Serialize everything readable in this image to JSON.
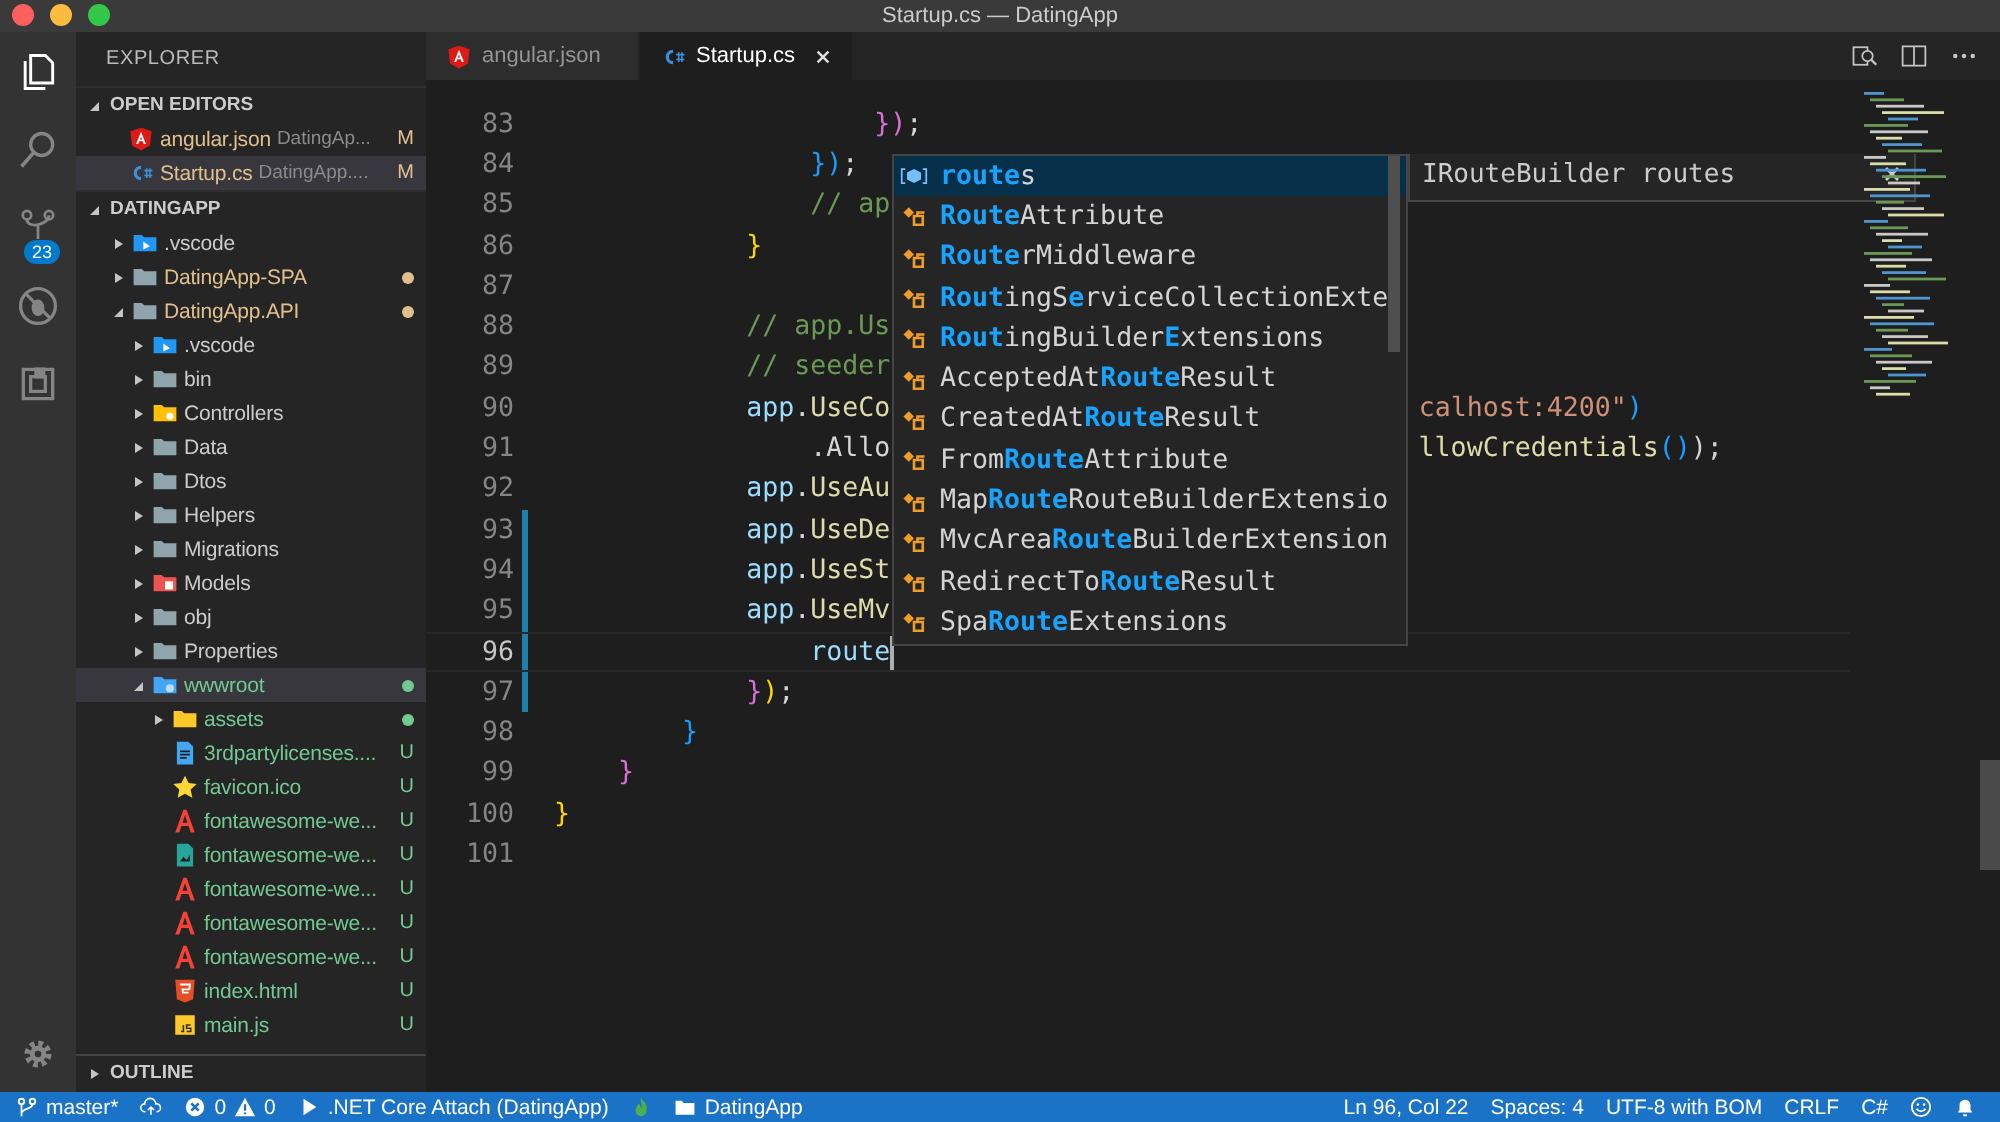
{
  "window": {
    "title": "Startup.cs — DatingApp"
  },
  "activity_bar": {
    "items": [
      {
        "kind": "files",
        "selected": true
      },
      {
        "kind": "search",
        "selected": false
      },
      {
        "kind": "scm",
        "selected": false,
        "badge": "23"
      },
      {
        "kind": "debug",
        "selected": false
      },
      {
        "kind": "extensions",
        "selected": false
      }
    ]
  },
  "sidebar": {
    "title": "EXPLORER",
    "open_editors": {
      "title": "OPEN EDITORS",
      "expanded": true,
      "items": [
        {
          "kind": "angular-file",
          "name": "angular.json",
          "description": "DatingAp...",
          "badge": "M",
          "color": "#e2c08d",
          "selected": false
        },
        {
          "kind": "csharp-file",
          "name": "Startup.cs",
          "description": "DatingApp....",
          "badge": "M",
          "color": "#e2c08d",
          "selected": true
        }
      ]
    },
    "project": {
      "title": "DATINGAPP",
      "expanded": true,
      "items": [
        {
          "kind": "vscode-folder",
          "name": ".vscode",
          "color": "#cccccc",
          "dot": false,
          "expanded": false,
          "selected": false
        },
        {
          "kind": "folder",
          "name": "DatingApp-SPA",
          "color": "#e2c08d",
          "dot": true,
          "expanded": false,
          "selected": false
        },
        {
          "kind": "folder",
          "name": "DatingApp.API",
          "color": "#e2c08d",
          "dot": true,
          "expanded": true,
          "selected": false,
          "children": [
            {
              "kind": "vscode-folder",
              "name": ".vscode",
              "color": "#cccccc",
              "dot": false,
              "expanded": false,
              "selected": false
            },
            {
              "kind": "folder",
              "name": "bin",
              "color": "#cccccc",
              "dot": false,
              "expanded": false,
              "selected": false
            },
            {
              "kind": "controllers-folder",
              "name": "Controllers",
              "color": "#cccccc",
              "dot": false,
              "expanded": false,
              "selected": false
            },
            {
              "kind": "folder",
              "name": "Data",
              "color": "#cccccc",
              "dot": false,
              "expanded": false,
              "selected": false
            },
            {
              "kind": "folder",
              "name": "Dtos",
              "color": "#cccccc",
              "dot": false,
              "expanded": false,
              "selected": false
            },
            {
              "kind": "folder",
              "name": "Helpers",
              "color": "#cccccc",
              "dot": false,
              "expanded": false,
              "selected": false
            },
            {
              "kind": "folder",
              "name": "Migrations",
              "color": "#cccccc",
              "dot": false,
              "expanded": false,
              "selected": false
            },
            {
              "kind": "models-folder",
              "name": "Models",
              "color": "#cccccc",
              "dot": false,
              "expanded": false,
              "selected": false
            },
            {
              "kind": "folder",
              "name": "obj",
              "color": "#cccccc",
              "dot": false,
              "expanded": false,
              "selected": false
            },
            {
              "kind": "folder",
              "name": "Properties",
              "color": "#cccccc",
              "dot": false,
              "expanded": false,
              "selected": false
            },
            {
              "kind": "web-folder",
              "name": "wwwroot",
              "color": "#73c991",
              "dot": true,
              "expanded": true,
              "selected": true,
              "children": [
                {
                  "kind": "assets-folder",
                  "name": "assets",
                  "color": "#73c991",
                  "dot": true,
                  "expanded": false,
                  "selected": false
                },
                {
                  "kind": "doc-file",
                  "name": "3rdpartylicenses....",
                  "color": "#73c991",
                  "badge": "U",
                  "selected": false
                },
                {
                  "kind": "star-file",
                  "name": "favicon.ico",
                  "color": "#73c991",
                  "badge": "U",
                  "selected": false
                },
                {
                  "kind": "font-file",
                  "name": "fontawesome-we...",
                  "color": "#73c991",
                  "badge": "U",
                  "selected": false
                },
                {
                  "kind": "image-file",
                  "name": "fontawesome-we...",
                  "color": "#73c991",
                  "badge": "U",
                  "selected": false
                },
                {
                  "kind": "font-file",
                  "name": "fontawesome-we...",
                  "color": "#73c991",
                  "badge": "U",
                  "selected": false
                },
                {
                  "kind": "font-file",
                  "name": "fontawesome-we...",
                  "color": "#73c991",
                  "badge": "U",
                  "selected": false
                },
                {
                  "kind": "font-file",
                  "name": "fontawesome-we...",
                  "color": "#73c991",
                  "badge": "U",
                  "selected": false
                },
                {
                  "kind": "html-file",
                  "name": "index.html",
                  "color": "#73c991",
                  "badge": "U",
                  "selected": false
                },
                {
                  "kind": "js-file",
                  "name": "main.js",
                  "color": "#73c991",
                  "badge": "U",
                  "selected": false
                }
              ]
            }
          ]
        }
      ]
    },
    "outline": {
      "title": "OUTLINE",
      "expanded": false
    }
  },
  "tabs": [
    {
      "kind": "angular-file",
      "label": "angular.json",
      "selected": false
    },
    {
      "kind": "csharp-file",
      "label": "Startup.cs",
      "selected": true
    }
  ],
  "editor": {
    "lines": [
      {
        "number": "83",
        "changed": false,
        "current": false,
        "tokens": [
          {
            "text": "                    })",
            "kind": "brace-p"
          },
          {
            "text": ";",
            "kind": "plain"
          }
        ]
      },
      {
        "number": "84",
        "changed": false,
        "current": false,
        "tokens": [
          {
            "text": "                })",
            "kind": "brace-b"
          },
          {
            "text": ";",
            "kind": "plain"
          }
        ]
      },
      {
        "number": "85",
        "changed": false,
        "current": false,
        "tokens": [
          {
            "text": "                // ap",
            "kind": "comment"
          }
        ]
      },
      {
        "number": "86",
        "changed": false,
        "current": false,
        "tokens": [
          {
            "text": "            }",
            "kind": "brace-y"
          }
        ]
      },
      {
        "number": "87",
        "changed": false,
        "current": false
      },
      {
        "number": "88",
        "changed": false,
        "current": false,
        "tokens": [
          {
            "text": "            // app.Us",
            "kind": "comment"
          }
        ]
      },
      {
        "number": "89",
        "changed": false,
        "current": false,
        "tokens": [
          {
            "text": "            // seeder",
            "kind": "comment"
          }
        ]
      },
      {
        "number": "90",
        "changed": false,
        "current": false,
        "tokens": [
          {
            "text": "            app",
            "kind": "var"
          },
          {
            "text": ".",
            "kind": "plain"
          },
          {
            "text": "UseCo",
            "kind": "func"
          }
        ],
        "tail": [
          {
            "text": "calhost:4200\"",
            "kind": "string"
          },
          {
            "text": ")",
            "kind": "brace-b"
          }
        ]
      },
      {
        "number": "91",
        "changed": false,
        "current": false,
        "tokens": [
          {
            "text": "                .Allo",
            "kind": "plain"
          }
        ],
        "tail": [
          {
            "text": "llowCredentials",
            "kind": "func"
          },
          {
            "text": "()",
            "kind": "brace-b"
          },
          {
            "text": ");",
            "kind": "plain"
          }
        ]
      },
      {
        "number": "92",
        "changed": false,
        "current": false,
        "tokens": [
          {
            "text": "            app",
            "kind": "var"
          },
          {
            "text": ".",
            "kind": "plain"
          },
          {
            "text": "UseAu",
            "kind": "func"
          }
        ]
      },
      {
        "number": "93",
        "changed": true,
        "current": false,
        "tokens": [
          {
            "text": "            app",
            "kind": "var"
          },
          {
            "text": ".",
            "kind": "plain"
          },
          {
            "text": "UseDe",
            "kind": "func"
          }
        ]
      },
      {
        "number": "94",
        "changed": true,
        "current": false,
        "tokens": [
          {
            "text": "            app",
            "kind": "var"
          },
          {
            "text": ".",
            "kind": "plain"
          },
          {
            "text": "UseSt",
            "kind": "func"
          }
        ]
      },
      {
        "number": "95",
        "changed": true,
        "current": false,
        "tokens": [
          {
            "text": "            app",
            "kind": "var"
          },
          {
            "text": ".",
            "kind": "plain"
          },
          {
            "text": "UseMv",
            "kind": "func"
          }
        ]
      },
      {
        "number": "96",
        "changed": true,
        "current": true,
        "tokens": [
          {
            "text": "                route",
            "kind": "var"
          }
        ]
      },
      {
        "number": "97",
        "changed": true,
        "current": false,
        "tokens": [
          {
            "text": "            }",
            "kind": "brace-p"
          },
          {
            "text": ")",
            "kind": "brace-y"
          },
          {
            "text": ";",
            "kind": "plain"
          }
        ]
      },
      {
        "number": "98",
        "changed": false,
        "current": false,
        "tokens": [
          {
            "text": "        }",
            "kind": "brace-b"
          }
        ]
      },
      {
        "number": "99",
        "changed": false,
        "current": false,
        "tokens": [
          {
            "text": "    }",
            "kind": "brace-p"
          }
        ]
      },
      {
        "number": "100",
        "changed": false,
        "current": false,
        "tokens": [
          {
            "text": "}",
            "kind": "brace-y"
          }
        ]
      },
      {
        "number": "101",
        "changed": false,
        "current": false
      }
    ],
    "suggest": {
      "detail": "IRouteBuilder routes",
      "items": [
        {
          "kind": "field",
          "selected": true,
          "parts": [
            {
              "text": "route",
              "match": true
            },
            {
              "text": "s",
              "match": false
            }
          ]
        },
        {
          "kind": "class",
          "selected": false,
          "parts": [
            {
              "text": "Route",
              "match": true
            },
            {
              "text": "Attribute",
              "match": false
            }
          ]
        },
        {
          "kind": "class",
          "selected": false,
          "parts": [
            {
              "text": "Route",
              "match": true
            },
            {
              "text": "r",
              "match": false
            },
            {
              "text": "Middleware",
              "match": false
            }
          ]
        },
        {
          "kind": "class",
          "selected": false,
          "parts": [
            {
              "text": "Rout",
              "match": true
            },
            {
              "text": "ingS",
              "match": false
            },
            {
              "text": "e",
              "match": true
            },
            {
              "text": "rviceCollectionExte",
              "match": false
            }
          ]
        },
        {
          "kind": "class",
          "selected": false,
          "parts": [
            {
              "text": "Rout",
              "match": true
            },
            {
              "text": "ingBuilder",
              "match": false
            },
            {
              "text": "E",
              "match": true
            },
            {
              "text": "xtensions",
              "match": false
            }
          ]
        },
        {
          "kind": "class",
          "selected": false,
          "parts": [
            {
              "text": "AcceptedAt",
              "match": false
            },
            {
              "text": "Route",
              "match": true
            },
            {
              "text": "Result",
              "match": false
            }
          ]
        },
        {
          "kind": "class",
          "selected": false,
          "parts": [
            {
              "text": "CreatedAt",
              "match": false
            },
            {
              "text": "Route",
              "match": true
            },
            {
              "text": "Result",
              "match": false
            }
          ]
        },
        {
          "kind": "class",
          "selected": false,
          "parts": [
            {
              "text": "From",
              "match": false
            },
            {
              "text": "Route",
              "match": true
            },
            {
              "text": "Attribute",
              "match": false
            }
          ]
        },
        {
          "kind": "class",
          "selected": false,
          "parts": [
            {
              "text": "Map",
              "match": false
            },
            {
              "text": "Route",
              "match": true
            },
            {
              "text": "RouteBuilderExtensio",
              "match": false
            }
          ]
        },
        {
          "kind": "class",
          "selected": false,
          "parts": [
            {
              "text": "MvcArea",
              "match": false
            },
            {
              "text": "Route",
              "match": true
            },
            {
              "text": "BuilderExtension",
              "match": false
            }
          ]
        },
        {
          "kind": "class",
          "selected": false,
          "parts": [
            {
              "text": "RedirectTo",
              "match": false
            },
            {
              "text": "Route",
              "match": true
            },
            {
              "text": "Result",
              "match": false
            }
          ]
        },
        {
          "kind": "class",
          "selected": false,
          "parts": [
            {
              "text": "Spa",
              "match": false
            },
            {
              "text": "Route",
              "match": true
            },
            {
              "text": "Extensions",
              "match": false
            }
          ]
        }
      ]
    }
  },
  "status_bar": {
    "branch": "master*",
    "errors": "0",
    "warnings": "0",
    "debug": ".NET Core Attach (DatingApp)",
    "folder": "DatingApp",
    "position": "Ln 96, Col 22",
    "spaces": "Spaces: 4",
    "encoding": "UTF-8 with BOM",
    "eol": "CRLF",
    "language": "C#"
  }
}
